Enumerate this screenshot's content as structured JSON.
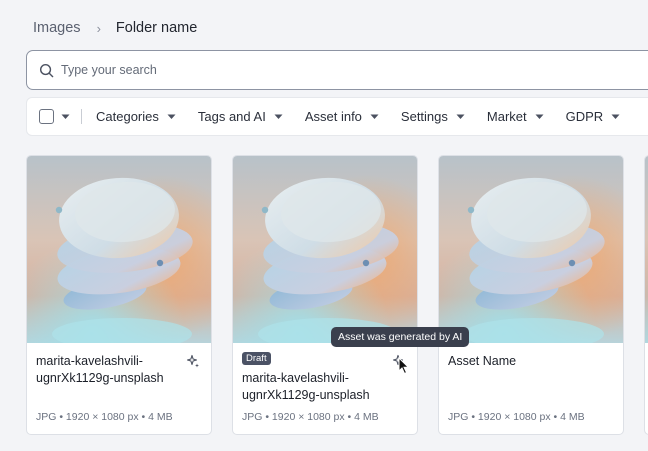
{
  "breadcrumb": {
    "root": "Images",
    "separator": "›",
    "current": "Folder name"
  },
  "search": {
    "placeholder": "Type your search",
    "value": ""
  },
  "filters": [
    "Categories",
    "Tags and AI",
    "Asset info",
    "Settings",
    "Market",
    "GDPR"
  ],
  "cards": [
    {
      "title": "marita-kavelashvili-ugnrXk1129g-unsplash",
      "meta": "JPG • 1920 × 1080 px • 4 MB",
      "badge": "",
      "ai": true
    },
    {
      "title": "marita-kavelashvili-ugnrXk1129g-unsplash",
      "meta": "JPG • 1920 × 1080 px • 4 MB",
      "badge": "Draft",
      "ai": true
    },
    {
      "title": "Asset Name",
      "meta": "JPG • 1920 × 1080 px • 4 MB",
      "badge": "",
      "ai": false
    }
  ],
  "tooltip": "Asset was generated by AI",
  "icons": {
    "search": "search-icon",
    "caret": "caret-down-icon",
    "ai": "sparkle-icon",
    "cursor": "mouse-pointer-icon"
  }
}
